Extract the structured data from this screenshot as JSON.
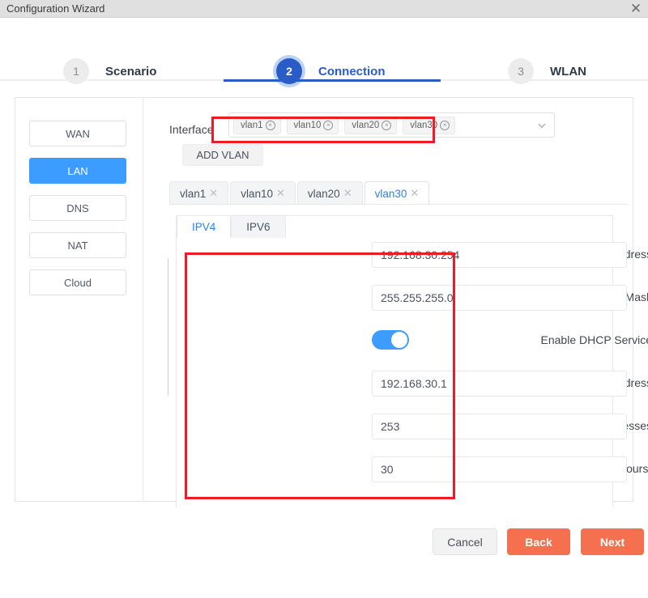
{
  "window": {
    "title": "Configuration Wizard",
    "close_icon": "close-icon",
    "close_glyph": "✕"
  },
  "stepper": {
    "steps": [
      {
        "number": "1",
        "label": "Scenario",
        "state": "inactive"
      },
      {
        "number": "2",
        "label": "Connection",
        "state": "active"
      },
      {
        "number": "3",
        "label": "WLAN",
        "state": "inactive"
      }
    ],
    "active_color": "#2a5cc8",
    "inactive_color": "#ececec"
  },
  "sidebar": {
    "items": [
      {
        "label": "WAN",
        "active": false
      },
      {
        "label": "LAN",
        "active": true
      },
      {
        "label": "DNS",
        "active": false
      },
      {
        "label": "NAT",
        "active": false
      },
      {
        "label": "Cloud",
        "active": false
      }
    ],
    "active_color": "#3d9cff"
  },
  "interface": {
    "label": "Interface",
    "tags": [
      {
        "label": "vlan1",
        "remove_glyph": "×"
      },
      {
        "label": "vlan10",
        "remove_glyph": "×"
      },
      {
        "label": "vlan20",
        "remove_glyph": "×"
      },
      {
        "label": "vlan30",
        "remove_glyph": "×"
      }
    ],
    "caret_glyph": "⌄",
    "caret_icon": "chevron-down-icon",
    "add_vlan_label": "ADD VLAN"
  },
  "vlan_tabs": [
    {
      "label": "vlan1",
      "close_glyph": "✕",
      "active": false
    },
    {
      "label": "vlan10",
      "close_glyph": "✕",
      "active": false
    },
    {
      "label": "vlan20",
      "close_glyph": "✕",
      "active": false
    },
    {
      "label": "vlan30",
      "close_glyph": "✕",
      "active": true
    }
  ],
  "ip_tabs": [
    {
      "label": "IPV4",
      "active": true
    },
    {
      "label": "IPV6",
      "active": false
    }
  ],
  "form": {
    "fields": [
      {
        "label": "IP Address",
        "required": false,
        "value": "192.168.30.254",
        "type": "text"
      },
      {
        "label": "Subnet Mask",
        "required": false,
        "value": "255.255.255.0",
        "type": "text"
      },
      {
        "label": "Enable DHCP Service",
        "required": false,
        "value": "on",
        "type": "switch"
      },
      {
        "label": "Start IP Address",
        "required": true,
        "value": "192.168.30.1",
        "type": "text"
      },
      {
        "label": "Number of Addresses",
        "required": true,
        "value": "253",
        "type": "text"
      },
      {
        "label": "Lease Time (hours)",
        "required": true,
        "value": "30",
        "type": "text"
      }
    ],
    "required_marker": "*",
    "required_color": "#f05a5a",
    "switch_on_color": "#3d9cff"
  },
  "annotations": {
    "color": "#ee1b24",
    "boxes": [
      {
        "name": "interface-tags-highlight"
      },
      {
        "name": "dhcp-form-highlight"
      }
    ]
  },
  "footer": {
    "cancel_label": "Cancel",
    "back_label": "Back",
    "next_label": "Next",
    "primary_color": "#f4704f"
  }
}
